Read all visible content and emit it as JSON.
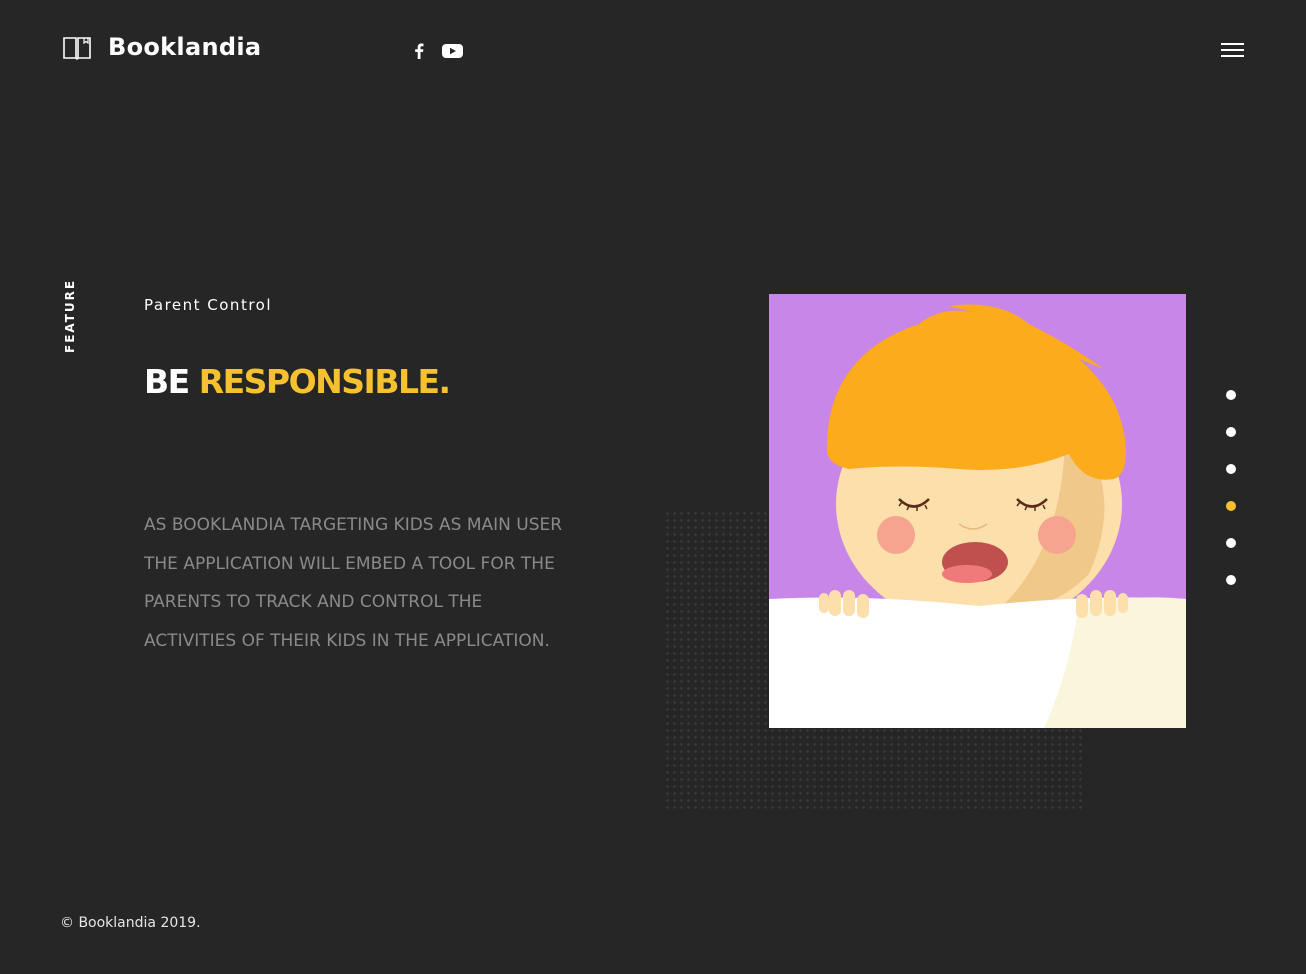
{
  "brand": {
    "name": "Booklandia",
    "logo_icon": "open-book-icon"
  },
  "social": [
    {
      "name": "facebook-icon"
    },
    {
      "name": "youtube-icon"
    }
  ],
  "menu": {
    "icon": "hamburger-menu-icon"
  },
  "section": {
    "side_label": "FEATURE",
    "subtitle": "Parent Control",
    "heading_plain": "BE",
    "heading_accent": "RESPONSIBLE.",
    "description": "As Booklandia targeting kids as main user the application will embed a tool for the parents to track and control the activities of their kids in the application."
  },
  "pager": {
    "count": 6,
    "active_index": 3
  },
  "footer": {
    "copyright": "© Booklandia 2019."
  },
  "colors": {
    "background": "#262626",
    "accent": "#f6c12f",
    "illustration_bg": "#c786e8",
    "hair": "#fbab1b",
    "skin": "#fcdfaa"
  }
}
